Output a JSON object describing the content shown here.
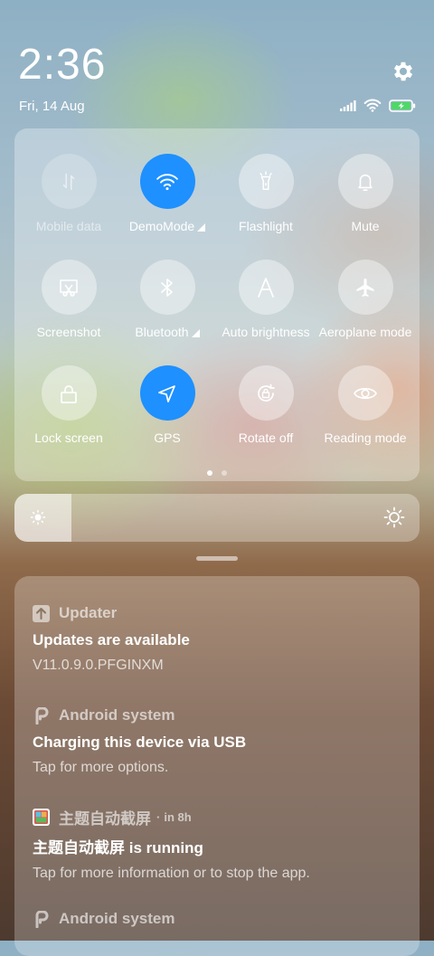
{
  "status_bar": {
    "time": "2:36",
    "date": "Fri, 14 Aug",
    "settings_icon": "gear-icon",
    "indicators": [
      "signal-icon",
      "wifi-icon",
      "battery-charging-icon"
    ]
  },
  "quick_settings": {
    "accent_color": "#1e90ff",
    "tiles": [
      {
        "label": "Mobile data",
        "icon": "mobile-data-icon",
        "state": "unavailable"
      },
      {
        "label": "DemoMode",
        "icon": "wifi-icon",
        "state": "on",
        "expandable": true
      },
      {
        "label": "Flashlight",
        "icon": "flashlight-icon",
        "state": "off"
      },
      {
        "label": "Mute",
        "icon": "bell-icon",
        "state": "off"
      },
      {
        "label": "Screenshot",
        "icon": "screenshot-icon",
        "state": "off"
      },
      {
        "label": "Bluetooth",
        "icon": "bluetooth-icon",
        "state": "off",
        "expandable": true
      },
      {
        "label": "Auto brightness",
        "icon": "auto-brightness-icon",
        "state": "off"
      },
      {
        "label": "Aeroplane mode",
        "icon": "airplane-icon",
        "state": "off"
      },
      {
        "label": "Lock screen",
        "icon": "lock-icon",
        "state": "off"
      },
      {
        "label": "GPS",
        "icon": "location-arrow-icon",
        "state": "on"
      },
      {
        "label": "Rotate off",
        "icon": "rotate-lock-icon",
        "state": "off"
      },
      {
        "label": "Reading mode",
        "icon": "eye-icon",
        "state": "off"
      }
    ],
    "page_count": 2,
    "current_page": 1
  },
  "brightness": {
    "level": 0.14,
    "icon_low": "brightness-low-icon",
    "icon_high": "brightness-high-icon"
  },
  "notifications": [
    {
      "app": "Updater",
      "icon": "updater-icon",
      "title": "Updates are available",
      "body": "V11.0.9.0.PFGINXM"
    },
    {
      "app": "Android system",
      "icon": "android-system-icon",
      "title": "Charging this device via USB",
      "body": "Tap for more options."
    },
    {
      "app": "主题自动截屏",
      "since": "in 8h",
      "icon": "app-thumbnail-icon",
      "title": "主题自动截屏 is running",
      "body": "Tap for more information or to stop the app."
    },
    {
      "app": "Android system",
      "icon": "android-system-icon",
      "title": "",
      "body": ""
    }
  ]
}
